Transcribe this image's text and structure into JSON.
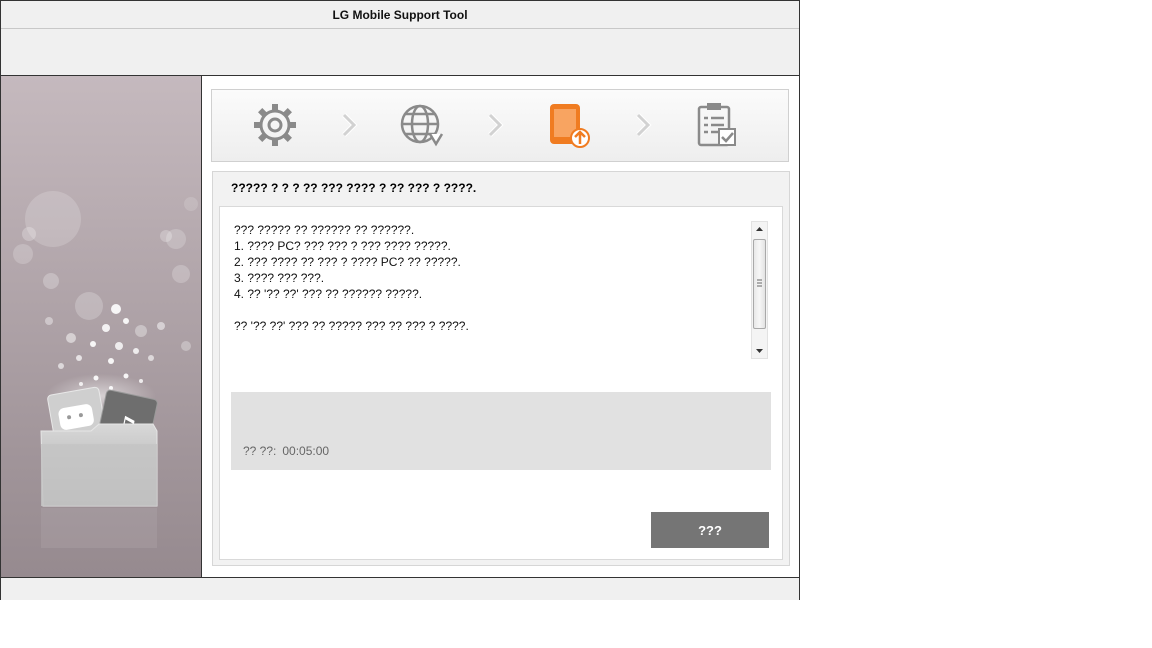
{
  "window": {
    "title": "LG Mobile Support Tool"
  },
  "steps": [
    {
      "icon": "gear-icon",
      "state": "done"
    },
    {
      "icon": "globe-download-icon",
      "state": "done"
    },
    {
      "icon": "phone-upload-icon",
      "state": "active"
    },
    {
      "icon": "clipboard-check-icon",
      "state": "pending"
    }
  ],
  "colors": {
    "active": "#f07c21",
    "inactive": "#8a8a8a",
    "button": "#757575"
  },
  "panel": {
    "instruction": "????? ? ? ? ?? ??? ???? ? ?? ??? ? ????.",
    "lines": [
      "??? ????? ?? ?????? ?? ??????.",
      "1. ???? PC? ??? ??? ? ??? ???? ?????.",
      "2. ??? ???? ?? ??? ? ???? PC? ?? ?????.",
      "3. ???? ??? ???.",
      "4. ?? '?? ??' ??? ?? ?????? ?????.",
      "",
      "?? '?? ??' ??? ?? ????? ??? ?? ??? ? ????."
    ],
    "progress": {
      "label": "?? ??:",
      "time": "00:05:00"
    },
    "cancel_label": "???"
  }
}
